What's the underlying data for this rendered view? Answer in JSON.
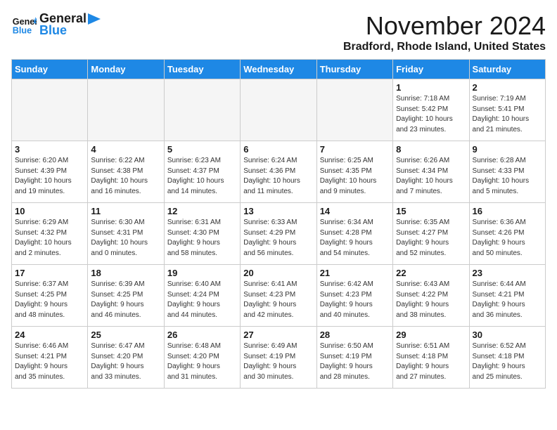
{
  "header": {
    "logo_line1": "General",
    "logo_line2": "Blue",
    "month_title": "November 2024",
    "location": "Bradford, Rhode Island, United States"
  },
  "weekdays": [
    "Sunday",
    "Monday",
    "Tuesday",
    "Wednesday",
    "Thursday",
    "Friday",
    "Saturday"
  ],
  "weeks": [
    [
      {
        "day": "",
        "detail": ""
      },
      {
        "day": "",
        "detail": ""
      },
      {
        "day": "",
        "detail": ""
      },
      {
        "day": "",
        "detail": ""
      },
      {
        "day": "",
        "detail": ""
      },
      {
        "day": "1",
        "detail": "Sunrise: 7:18 AM\nSunset: 5:42 PM\nDaylight: 10 hours\nand 23 minutes."
      },
      {
        "day": "2",
        "detail": "Sunrise: 7:19 AM\nSunset: 5:41 PM\nDaylight: 10 hours\nand 21 minutes."
      }
    ],
    [
      {
        "day": "3",
        "detail": "Sunrise: 6:20 AM\nSunset: 4:39 PM\nDaylight: 10 hours\nand 19 minutes."
      },
      {
        "day": "4",
        "detail": "Sunrise: 6:22 AM\nSunset: 4:38 PM\nDaylight: 10 hours\nand 16 minutes."
      },
      {
        "day": "5",
        "detail": "Sunrise: 6:23 AM\nSunset: 4:37 PM\nDaylight: 10 hours\nand 14 minutes."
      },
      {
        "day": "6",
        "detail": "Sunrise: 6:24 AM\nSunset: 4:36 PM\nDaylight: 10 hours\nand 11 minutes."
      },
      {
        "day": "7",
        "detail": "Sunrise: 6:25 AM\nSunset: 4:35 PM\nDaylight: 10 hours\nand 9 minutes."
      },
      {
        "day": "8",
        "detail": "Sunrise: 6:26 AM\nSunset: 4:34 PM\nDaylight: 10 hours\nand 7 minutes."
      },
      {
        "day": "9",
        "detail": "Sunrise: 6:28 AM\nSunset: 4:33 PM\nDaylight: 10 hours\nand 5 minutes."
      }
    ],
    [
      {
        "day": "10",
        "detail": "Sunrise: 6:29 AM\nSunset: 4:32 PM\nDaylight: 10 hours\nand 2 minutes."
      },
      {
        "day": "11",
        "detail": "Sunrise: 6:30 AM\nSunset: 4:31 PM\nDaylight: 10 hours\nand 0 minutes."
      },
      {
        "day": "12",
        "detail": "Sunrise: 6:31 AM\nSunset: 4:30 PM\nDaylight: 9 hours\nand 58 minutes."
      },
      {
        "day": "13",
        "detail": "Sunrise: 6:33 AM\nSunset: 4:29 PM\nDaylight: 9 hours\nand 56 minutes."
      },
      {
        "day": "14",
        "detail": "Sunrise: 6:34 AM\nSunset: 4:28 PM\nDaylight: 9 hours\nand 54 minutes."
      },
      {
        "day": "15",
        "detail": "Sunrise: 6:35 AM\nSunset: 4:27 PM\nDaylight: 9 hours\nand 52 minutes."
      },
      {
        "day": "16",
        "detail": "Sunrise: 6:36 AM\nSunset: 4:26 PM\nDaylight: 9 hours\nand 50 minutes."
      }
    ],
    [
      {
        "day": "17",
        "detail": "Sunrise: 6:37 AM\nSunset: 4:25 PM\nDaylight: 9 hours\nand 48 minutes."
      },
      {
        "day": "18",
        "detail": "Sunrise: 6:39 AM\nSunset: 4:25 PM\nDaylight: 9 hours\nand 46 minutes."
      },
      {
        "day": "19",
        "detail": "Sunrise: 6:40 AM\nSunset: 4:24 PM\nDaylight: 9 hours\nand 44 minutes."
      },
      {
        "day": "20",
        "detail": "Sunrise: 6:41 AM\nSunset: 4:23 PM\nDaylight: 9 hours\nand 42 minutes."
      },
      {
        "day": "21",
        "detail": "Sunrise: 6:42 AM\nSunset: 4:23 PM\nDaylight: 9 hours\nand 40 minutes."
      },
      {
        "day": "22",
        "detail": "Sunrise: 6:43 AM\nSunset: 4:22 PM\nDaylight: 9 hours\nand 38 minutes."
      },
      {
        "day": "23",
        "detail": "Sunrise: 6:44 AM\nSunset: 4:21 PM\nDaylight: 9 hours\nand 36 minutes."
      }
    ],
    [
      {
        "day": "24",
        "detail": "Sunrise: 6:46 AM\nSunset: 4:21 PM\nDaylight: 9 hours\nand 35 minutes."
      },
      {
        "day": "25",
        "detail": "Sunrise: 6:47 AM\nSunset: 4:20 PM\nDaylight: 9 hours\nand 33 minutes."
      },
      {
        "day": "26",
        "detail": "Sunrise: 6:48 AM\nSunset: 4:20 PM\nDaylight: 9 hours\nand 31 minutes."
      },
      {
        "day": "27",
        "detail": "Sunrise: 6:49 AM\nSunset: 4:19 PM\nDaylight: 9 hours\nand 30 minutes."
      },
      {
        "day": "28",
        "detail": "Sunrise: 6:50 AM\nSunset: 4:19 PM\nDaylight: 9 hours\nand 28 minutes."
      },
      {
        "day": "29",
        "detail": "Sunrise: 6:51 AM\nSunset: 4:18 PM\nDaylight: 9 hours\nand 27 minutes."
      },
      {
        "day": "30",
        "detail": "Sunrise: 6:52 AM\nSunset: 4:18 PM\nDaylight: 9 hours\nand 25 minutes."
      }
    ]
  ]
}
